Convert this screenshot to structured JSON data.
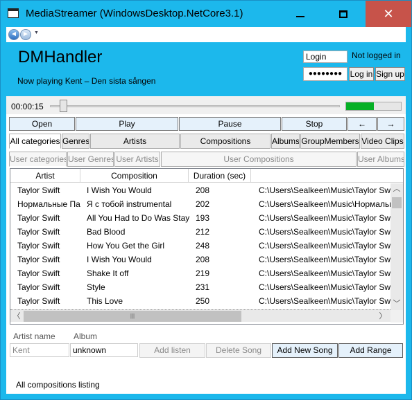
{
  "window": {
    "title": "MediaStreamer (WindowsDesktop.NetCore3.1)",
    "controls": {
      "minimize": "minimize-icon",
      "maximize": "maximize-icon",
      "close": "✕"
    }
  },
  "nav": {
    "back": "◄",
    "forward": "►",
    "dropdown": "▼"
  },
  "header": {
    "app_title": "DMHandler",
    "now_playing": "Now playing Kent – Den sista sången",
    "login_value": "Login",
    "login_status": "Not logged in",
    "password_mask": "●●●●●●●●",
    "login_button": "Log in",
    "signup_button": "Sign up"
  },
  "player": {
    "time": "00:00:15",
    "slider_position": 0.04,
    "volume_level": 0.5
  },
  "controls": [
    "Open",
    "Play",
    "Pause",
    "Stop",
    "←",
    "→"
  ],
  "tabs": [
    "All categories",
    "Genres",
    "Artists",
    "Compositions",
    "Albums",
    "GroupMembers",
    "Video Clips"
  ],
  "user_tabs": [
    "User categories",
    "User Genres",
    "User Artists",
    "User Compositions",
    "User Albums"
  ],
  "grid": {
    "columns": [
      "Artist",
      "Composition",
      "Duration (sec)"
    ],
    "rows": [
      [
        "Taylor Swift",
        "I Wish You Would",
        "208",
        "C:\\Users\\Sealkeen\\Music\\Taylor Swi"
      ],
      [
        "Нормальные Па",
        "Я с тобой instrumental",
        "202",
        "C:\\Users\\Sealkeen\\Music\\Нормальн"
      ],
      [
        "Taylor Swift",
        "All You Had to Do Was Stay",
        "193",
        "C:\\Users\\Sealkeen\\Music\\Taylor Swi"
      ],
      [
        "Taylor Swift",
        "Bad Blood",
        "212",
        "C:\\Users\\Sealkeen\\Music\\Taylor Swi"
      ],
      [
        "Taylor Swift",
        "How You Get the Girl",
        "248",
        "C:\\Users\\Sealkeen\\Music\\Taylor Swi"
      ],
      [
        "Taylor Swift",
        "I Wish You Would",
        "208",
        "C:\\Users\\Sealkeen\\Music\\Taylor Swi"
      ],
      [
        "Taylor Swift",
        "Shake It off",
        "219",
        "C:\\Users\\Sealkeen\\Music\\Taylor Swi"
      ],
      [
        "Taylor Swift",
        "Style",
        "231",
        "C:\\Users\\Sealkeen\\Music\\Taylor Swi"
      ],
      [
        "Taylor Swift",
        "This Love",
        "250",
        "C:\\Users\\Sealkeen\\Music\\Taylor Swi"
      ]
    ],
    "scroll": {
      "up": "︿",
      "down": "﹀",
      "left": "〈",
      "right": "〉",
      "grip": "|||"
    }
  },
  "form": {
    "artist_label": "Artist name",
    "album_label": "Album",
    "artist_value": "Kent",
    "album_value": "unknown",
    "add_listen": "Add listen",
    "delete_song": "Delete Song",
    "add_new_song": "Add New Song",
    "add_range": "Add Range"
  },
  "status": "All compositions listing",
  "colors": {
    "accent": "#1cb8ec",
    "close": "#c7534a",
    "volume": "#06b025"
  }
}
